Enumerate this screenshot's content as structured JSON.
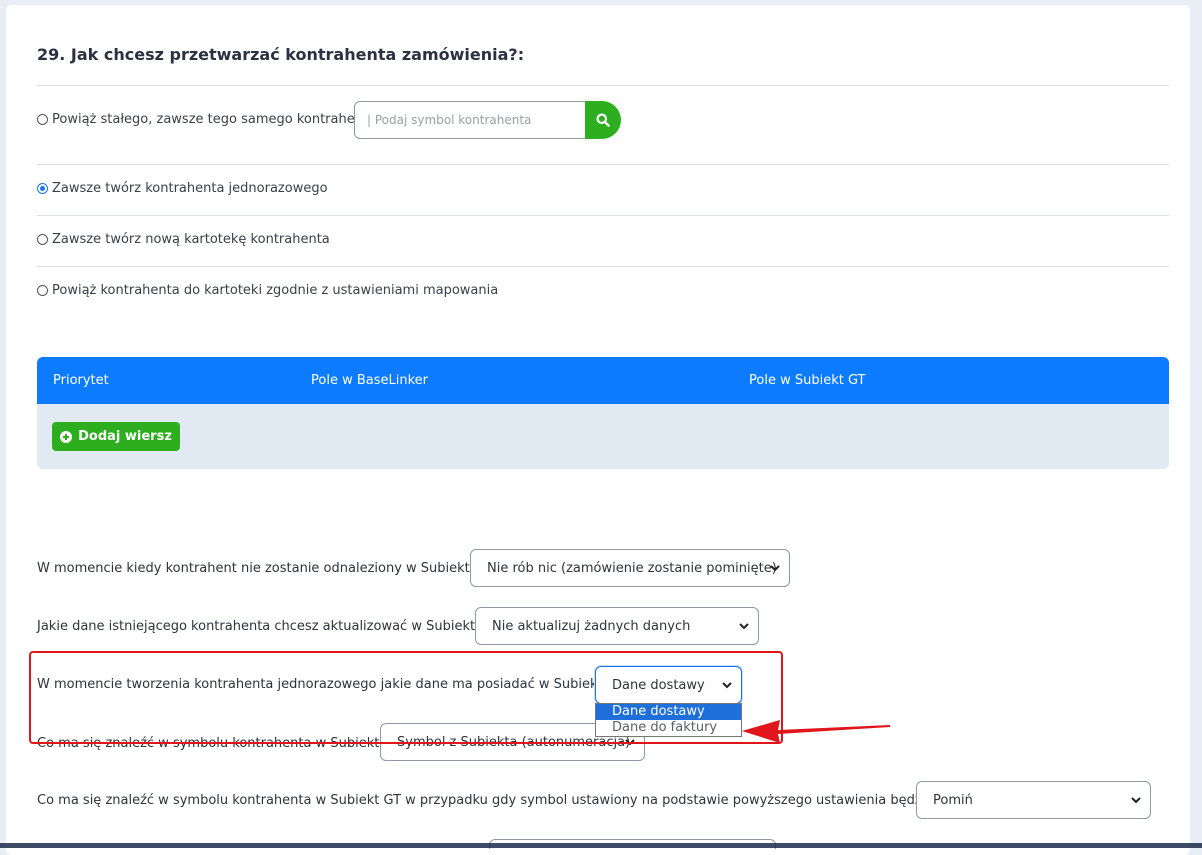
{
  "question": {
    "title": "29. Jak chcesz przetwarzać kontrahenta zamówienia?:"
  },
  "options": [
    {
      "label": "Powiąż stałego, zawsze tego samego kontrahenta",
      "checked": false
    },
    {
      "label": "Zawsze twórz kontrahenta jednorazowego",
      "checked": true
    },
    {
      "label": "Zawsze twórz nową kartotekę kontrahenta",
      "checked": false
    },
    {
      "label": "Powiąż kontrahenta do kartoteki zgodnie z ustawieniami mapowania",
      "checked": false
    }
  ],
  "search": {
    "placeholder": "| Podaj symbol kontrahenta",
    "icon": "search-icon"
  },
  "mapping_table": {
    "headers": [
      "Priorytet",
      "Pole w BaseLinker",
      "Pole w Subiekt GT"
    ],
    "add_row_label": "Dodaj wiersz",
    "header_color": "#0c7bff"
  },
  "settings": [
    {
      "label": "W momencie kiedy kontrahent nie zostanie odnaleziony w Subiekt GT:",
      "value": "Nie rób nic (zamówienie zostanie pominięte)"
    },
    {
      "label": "Jakie dane istniejącego kontrahenta chcesz aktualizować w Subiekt GT:",
      "value": "Nie aktualizuj żadnych danych"
    },
    {
      "label": "W momencie tworzenia kontrahenta jednorazowego jakie dane ma posiadać w Subiekt GT:",
      "value": "Dane dostawy"
    },
    {
      "label": "Co ma się znaleźć w symbolu kontrahenta w Subiekt GT:",
      "value": "Symbol z Subiekta (autonumeracja)"
    },
    {
      "label": "Co ma się znaleźć w symbolu kontrahenta w Subiekt GT w przypadku gdy symbol ustawiony na podstawie powyższego ustawienia będzie pusty",
      "value": "Pomiń"
    }
  ],
  "dropdown_open": {
    "options": [
      "Dane dostawy",
      "Dane do faktury"
    ],
    "selected": "Dane dostawy"
  },
  "colors": {
    "accent_green": "#2dae1f",
    "annotation_red": "#e0161c",
    "select_highlight": "#1e6fd9"
  }
}
